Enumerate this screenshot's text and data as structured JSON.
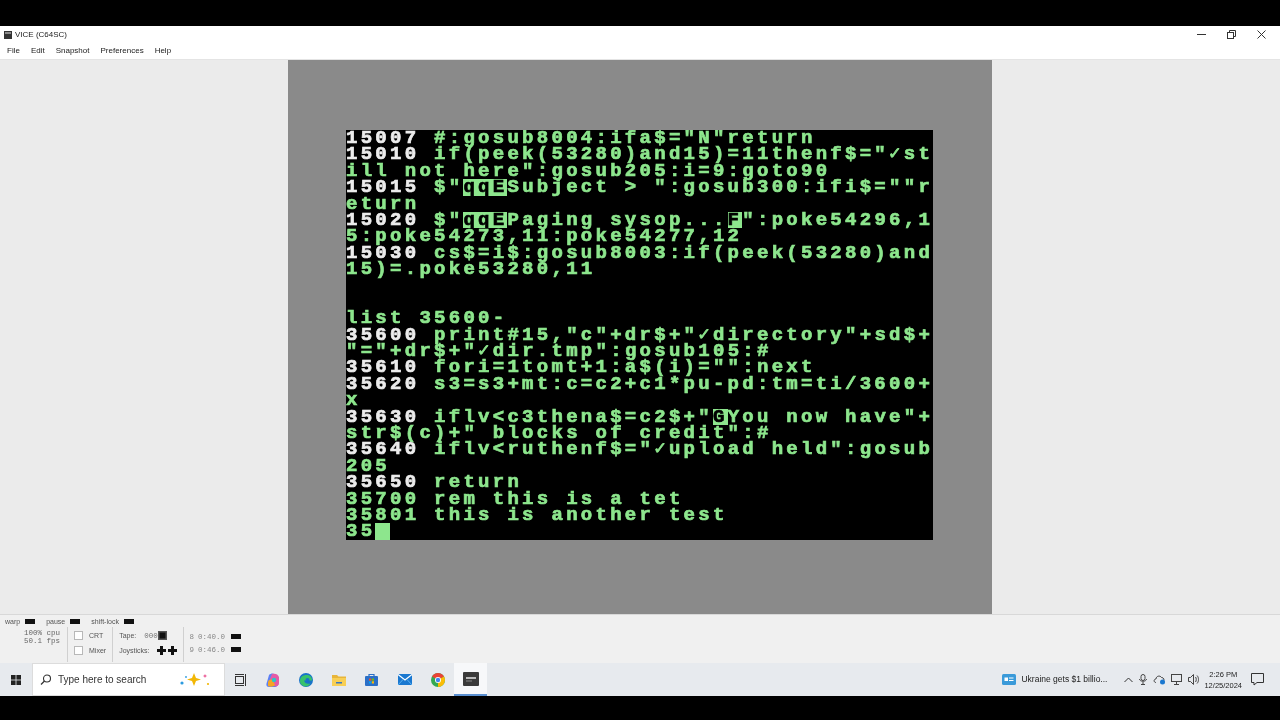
{
  "window": {
    "title": "VICE (C64SC)"
  },
  "menu": [
    {
      "label": "File"
    },
    {
      "label": "Edit"
    },
    {
      "label": "Snapshot"
    },
    {
      "label": "Preferences"
    },
    {
      "label": "Help"
    }
  ],
  "screen": {
    "blocks": [
      {
        "lines": [
          {
            "segments": [
              {
                "kind": "number",
                "text": "15007",
                "bright": true
              },
              {
                "kind": "code",
                "text": "#:gosub8004:ifa$=\"N\"return",
                "bright": false
              }
            ]
          },
          {
            "segments": [
              {
                "kind": "number",
                "text": "15010",
                "bright": true
              },
              {
                "kind": "code",
                "text": "if(peek(53280)and15)=11thenf$=\"✓st",
                "bright": false
              }
            ]
          },
          {
            "segments": [
              {
                "kind": "code",
                "text": "ill not here\":gosub205:i=9:goto90",
                "bright": false
              }
            ]
          },
          {
            "segments": [
              {
                "kind": "number",
                "text": "15015",
                "bright": true
              },
              {
                "kind": "code",
                "text": "$\"",
                "bright": false
              },
              {
                "kind": "reverse",
                "text": "qqE",
                "bright": false
              },
              {
                "kind": "code",
                "text": "Subject > \":gosub300:ifi$=\"\"r",
                "bright": false
              }
            ]
          },
          {
            "segments": [
              {
                "kind": "code",
                "text": "eturn",
                "bright": false
              }
            ]
          },
          {
            "segments": [
              {
                "kind": "number",
                "text": "15020",
                "bright": true
              },
              {
                "kind": "code",
                "text": "$\"",
                "bright": false
              },
              {
                "kind": "reverse",
                "text": "qqE",
                "bright": false
              },
              {
                "kind": "code",
                "text": "Paging sysop...",
                "bright": false
              },
              {
                "kind": "reverse",
                "text": "F",
                "bright": false
              },
              {
                "kind": "code",
                "text": "\":poke54296,1",
                "bright": false
              }
            ]
          },
          {
            "segments": [
              {
                "kind": "code",
                "text": "5:poke54273,11:poke54277,12",
                "bright": false
              }
            ]
          },
          {
            "segments": [
              {
                "kind": "number",
                "text": "15030",
                "bright": true
              },
              {
                "kind": "code",
                "text": "cs$=i$:gosub8003:if(peek(53280)and",
                "bright": false
              }
            ]
          },
          {
            "segments": [
              {
                "kind": "code",
                "text": "15)=.poke53280,11",
                "bright": false
              }
            ]
          }
        ]
      },
      {
        "lines": [
          {
            "segments": [
              {
                "kind": "code",
                "text": "list 35600-",
                "bright": false
              }
            ]
          },
          {
            "segments": [
              {
                "kind": "number",
                "text": "35600",
                "bright": true
              },
              {
                "kind": "code",
                "text": "print#15,\"c\"+dr$+\"✓directory\"+sd$+",
                "bright": false
              }
            ]
          },
          {
            "segments": [
              {
                "kind": "code",
                "text": "\"=\"+dr$+\"✓dir.tmp\":gosub105:#",
                "bright": false
              }
            ]
          },
          {
            "segments": [
              {
                "kind": "number",
                "text": "35610",
                "bright": true
              },
              {
                "kind": "code",
                "text": "fori=1tomt+1:a$(i)=\"\":next",
                "bright": false
              }
            ]
          },
          {
            "segments": [
              {
                "kind": "number",
                "text": "35620",
                "bright": true
              },
              {
                "kind": "code",
                "text": "s3=s3+mt:c=c2+c1*pu-pd:tm=ti/3600+",
                "bright": false
              }
            ]
          },
          {
            "segments": [
              {
                "kind": "code",
                "text": "x",
                "bright": false
              }
            ]
          },
          {
            "segments": [
              {
                "kind": "number",
                "text": "35630",
                "bright": true
              },
              {
                "kind": "code",
                "text": "iflv<c3thena$=c2$+\"",
                "bright": false
              },
              {
                "kind": "reverse",
                "text": "G",
                "bright": false
              },
              {
                "kind": "code",
                "text": "You now have\"+",
                "bright": false
              }
            ]
          },
          {
            "segments": [
              {
                "kind": "code",
                "text": "str$(c)+\" blocks of credit\":#",
                "bright": false
              }
            ]
          },
          {
            "segments": [
              {
                "kind": "number",
                "text": "35640",
                "bright": true
              },
              {
                "kind": "code",
                "text": "iflv<ruthenf$=\"✓upload held\":gosub",
                "bright": false
              }
            ]
          },
          {
            "segments": [
              {
                "kind": "code",
                "text": "205",
                "bright": false
              }
            ]
          },
          {
            "segments": [
              {
                "kind": "number",
                "text": "35650",
                "bright": true
              },
              {
                "kind": "code",
                "text": "return",
                "bright": false
              }
            ]
          },
          {
            "segments": [
              {
                "kind": "number",
                "text": "35700",
                "bright": false
              },
              {
                "kind": "code",
                "text": "rem this is a tet",
                "bright": false
              }
            ]
          },
          {
            "segments": [
              {
                "kind": "number",
                "text": "35801",
                "bright": false
              },
              {
                "kind": "code",
                "text": "this is another test",
                "bright": false
              }
            ]
          },
          {
            "segments": [
              {
                "kind": "code",
                "text": "35",
                "bright": false
              }
            ]
          }
        ]
      }
    ],
    "cursor": true
  },
  "status_bar": {
    "indicators": [
      {
        "label": "warp",
        "on": false
      },
      {
        "label": "pause",
        "on": false
      },
      {
        "label": "shift-lock",
        "on": false
      }
    ],
    "cpu": "100% cpu",
    "fps": "50.1 fps",
    "toggles": [
      {
        "label": "CRT",
        "checked": false
      },
      {
        "label": "Mixer",
        "checked": false
      }
    ],
    "tape": {
      "label": "Tape:",
      "counter": "000"
    },
    "joysticks": {
      "label": "Joysticks:"
    },
    "drives": [
      {
        "unit": "8",
        "track": "0:40.0",
        "led_on": false
      },
      {
        "unit": "9",
        "track": "0:46.0",
        "led_on": false
      }
    ]
  },
  "taskbar": {
    "search": {
      "placeholder": "Type here to search"
    },
    "apps": [
      {
        "kind": "copilot",
        "selected": false
      },
      {
        "kind": "edge",
        "selected": false
      },
      {
        "kind": "explorer",
        "selected": false
      },
      {
        "kind": "store",
        "selected": false
      },
      {
        "kind": "mail",
        "selected": false
      },
      {
        "kind": "chrome",
        "selected": false
      },
      {
        "kind": "vice",
        "selected": true
      }
    ],
    "news": {
      "headline": "Ukraine gets $1 billio..."
    },
    "clock": {
      "time": "2:26 PM",
      "date": "12/25/2024"
    }
  }
}
